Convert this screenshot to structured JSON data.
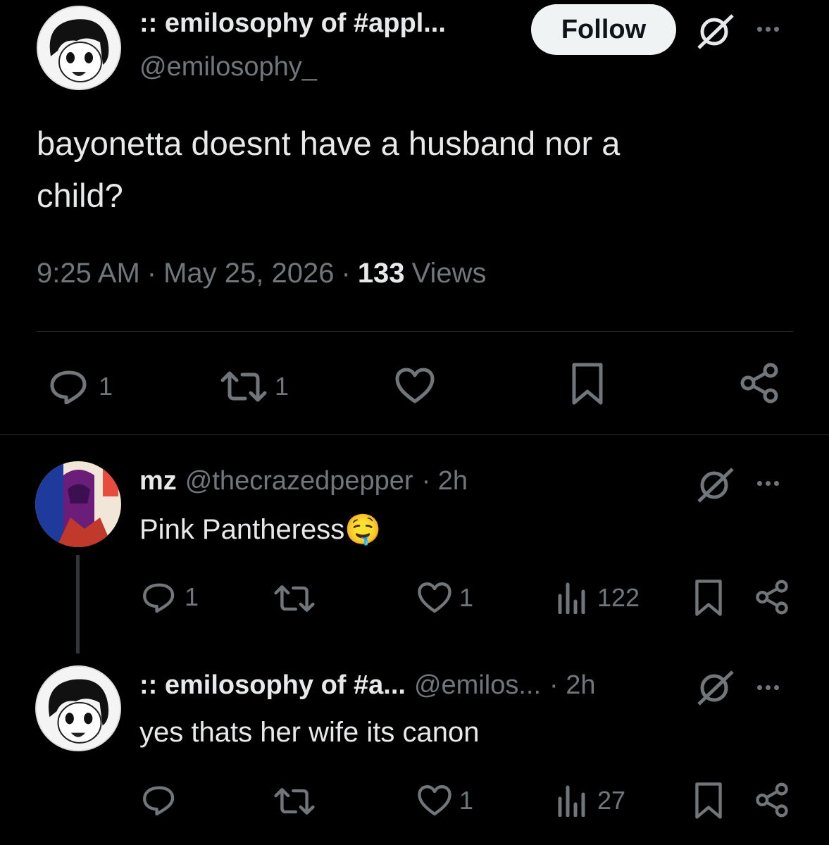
{
  "main_tweet": {
    "display_name": ":: emilosophy of #appl...",
    "handle": "@emilosophy_",
    "follow_label": "Follow",
    "text_line1": "bayonetta doesnt have a husband nor a",
    "text_line2": "child?",
    "time": "9:25 AM",
    "sep": "·",
    "date": "May 25, 2026",
    "views_count": "133",
    "views_label": "Views",
    "reply_count": "1",
    "retweet_count": "1"
  },
  "reply1": {
    "display_name": "mz",
    "handle": "@thecrazedpepper",
    "time": "· 2h",
    "text": "Pink Pantheress",
    "emoji": "🤤",
    "reply_count": "1",
    "like_count": "1",
    "views_count": "122"
  },
  "reply2": {
    "display_name": ":: emilosophy of #a...",
    "handle": "@emilos...",
    "time": "· 2h",
    "text": "yes thats her wife its canon",
    "like_count": "1",
    "views_count": "27"
  },
  "icons": {
    "reply": "reply-icon",
    "retweet": "retweet-icon",
    "like": "heart-icon",
    "bookmark": "bookmark-icon",
    "share": "share-icon",
    "views": "views-icon",
    "grok": "grok-icon",
    "more": "more-icon"
  },
  "colors": {
    "background": "#000000",
    "text": "#e7e9ea",
    "muted": "#71767b",
    "divider": "#2f3336",
    "follow_bg": "#eff3f4"
  }
}
